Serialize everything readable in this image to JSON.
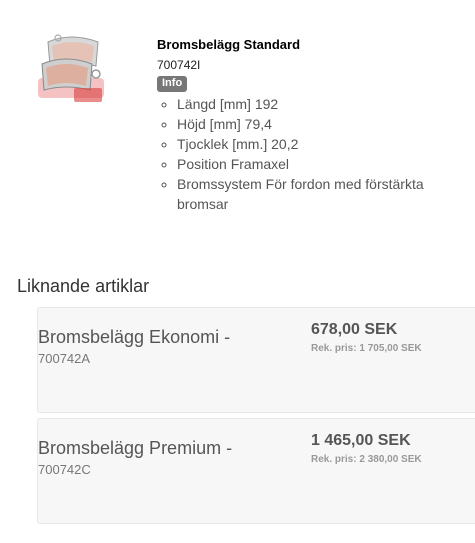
{
  "product": {
    "image_alt": "brake-pads-image",
    "title": "Bromsbelägg Standard",
    "sku": "700742I",
    "info_label": "Info",
    "specs": [
      "Längd [mm] 192",
      "Höjd [mm] 79,4",
      "Tjocklek [mm.] 20,2",
      "Position Framaxel",
      "Bromssystem För fordon med förstärkta bromsar"
    ]
  },
  "similar": {
    "heading": "Liknande artiklar",
    "items": [
      {
        "name": "Bromsbelägg Ekonomi -",
        "sku": "700742A",
        "price": "678,00 SEK",
        "rek_price": "Rek. pris: 1 705,00 SEK"
      },
      {
        "name": "Bromsbelägg Premium -",
        "sku": "700742C",
        "price": "1 465,00 SEK",
        "rek_price": "Rek. pris: 2 380,00 SEK"
      }
    ]
  }
}
